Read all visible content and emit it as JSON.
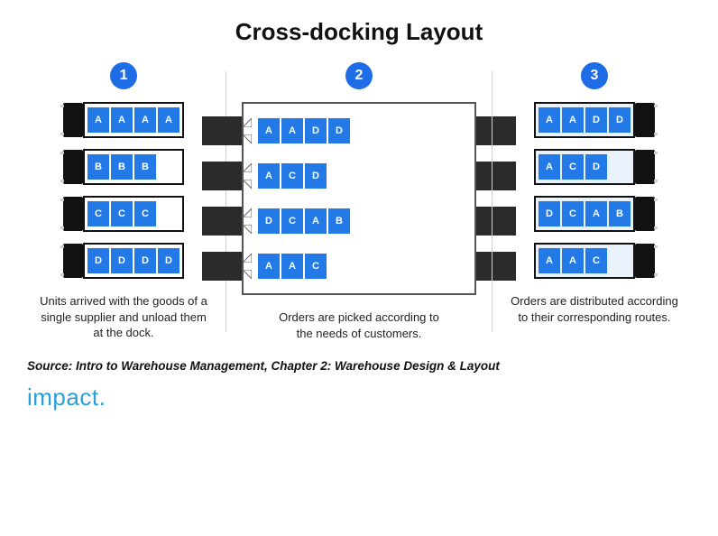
{
  "title": "Cross-docking Layout",
  "columns": {
    "left": {
      "badge": "1",
      "trucks": [
        {
          "crates": [
            "A",
            "A",
            "A",
            "A"
          ]
        },
        {
          "crates": [
            "B",
            "B",
            "B"
          ]
        },
        {
          "crates": [
            "C",
            "C",
            "C"
          ]
        },
        {
          "crates": [
            "D",
            "D",
            "D",
            "D"
          ]
        }
      ],
      "caption": "Units arrived with the goods of a single supplier and unload them at the dock."
    },
    "center": {
      "badge": "2",
      "rows": [
        {
          "crates": [
            "A",
            "A",
            "D",
            "D"
          ]
        },
        {
          "crates": [
            "A",
            "C",
            "D"
          ]
        },
        {
          "crates": [
            "D",
            "C",
            "A",
            "B"
          ]
        },
        {
          "crates": [
            "A",
            "A",
            "C"
          ]
        }
      ],
      "caption": "Orders are picked according to the needs of customers."
    },
    "right": {
      "badge": "3",
      "trucks": [
        {
          "crates": [
            "A",
            "A",
            "D",
            "D"
          ]
        },
        {
          "crates": [
            "A",
            "C",
            "D"
          ]
        },
        {
          "crates": [
            "D",
            "C",
            "A",
            "B"
          ]
        },
        {
          "crates": [
            "A",
            "A",
            "C"
          ]
        }
      ],
      "caption": "Orders are distributed according to their corresponding routes."
    }
  },
  "source": "Source: Intro to Warehouse Management, Chapter 2: Warehouse Design & Layout",
  "logo": "impact."
}
